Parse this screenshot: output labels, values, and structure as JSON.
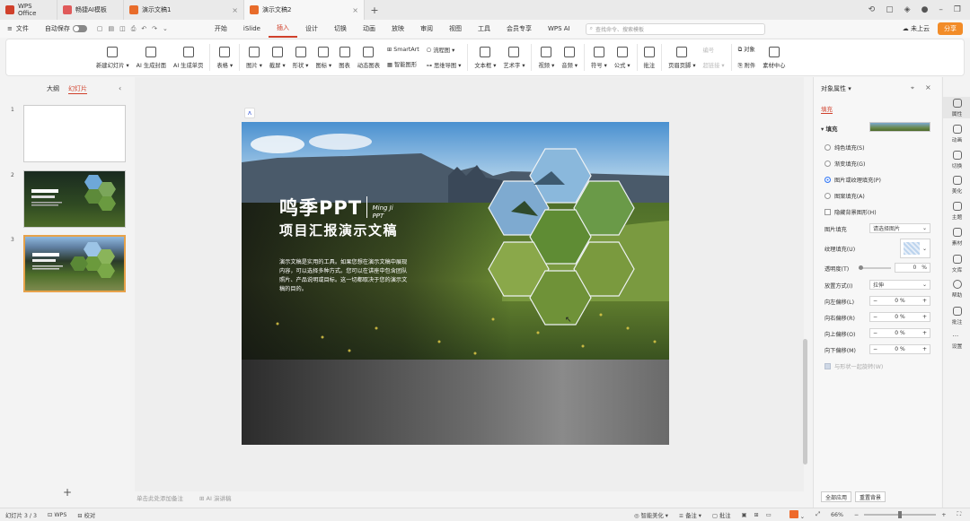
{
  "window": {
    "tabs": [
      {
        "label": "WPS Office",
        "icon": "wps-logo-icon",
        "color": "#d0402b"
      },
      {
        "label": "畅捷AI模板",
        "icon": "template-icon",
        "color": "#e05a5a"
      },
      {
        "label": "演示文稿1",
        "icon": "ppt-icon",
        "color": "#e86c2b"
      },
      {
        "label": "演示文稿2",
        "icon": "ppt-icon",
        "color": "#e86c2b"
      }
    ],
    "new_tab": "+"
  },
  "menubar": {
    "file": "文件",
    "autosave": "自动保存",
    "items": [
      "开始",
      "iSlide",
      "插入",
      "设计",
      "切换",
      "动画",
      "放映",
      "审阅",
      "视图",
      "工具",
      "会员专享",
      "WPS AI"
    ],
    "active": "插入",
    "search_placeholder": "查找命令、搜索模板",
    "not_cloud": "未上云",
    "share": "分享"
  },
  "ribbon": {
    "groups": [
      {
        "label": "新建幻灯片 ▾"
      },
      {
        "label": "AI 生成封面"
      },
      {
        "label": "AI 生成单页"
      },
      {
        "label": "表格 ▾"
      },
      {
        "label": "图片 ▾"
      },
      {
        "label": "截屏 ▾"
      },
      {
        "label": "形状 ▾"
      },
      {
        "label": "图标 ▾"
      },
      {
        "label": "图表"
      },
      {
        "label": "动态图表"
      }
    ],
    "smartart": "SmartArt",
    "smart_graphic": "智能图形",
    "flowchart": "流程图 ▾",
    "mindmap": "思维导图 ▾",
    "groups2": [
      {
        "label": "文本框 ▾"
      },
      {
        "label": "艺术字 ▾"
      },
      {
        "label": "视频 ▾"
      },
      {
        "label": "音频 ▾"
      },
      {
        "label": "符号 ▾"
      },
      {
        "label": "公式 ▾"
      },
      {
        "label": "批注"
      },
      {
        "label": "页眉页脚 ▾"
      }
    ],
    "disabled": [
      "编号",
      "超链接 ▾"
    ],
    "object": "对象",
    "attachment": "附件",
    "materials": "素材中心"
  },
  "leftpanel": {
    "tab_outline": "大纲",
    "tab_slides": "幻灯片",
    "slide_numbers": [
      "1",
      "2",
      "3"
    ],
    "add": "+"
  },
  "slide": {
    "title_main": "鸣季PPT",
    "title_en": "Ming Ji\nPPT",
    "subtitle": "项目汇报演示文稿",
    "body": "演示文稿是实用的工具。如果您想在演示文稿中展现内容，可以选择多种方式。您可以在讲座中包含团队照片、产品说明或目标。这一切都取决于您的演示文稿的目的。"
  },
  "notes": {
    "placeholder": "单击此处添加备注",
    "ai_script": "AI 演讲稿"
  },
  "rightpanel": {
    "title": "对象属性 ▾",
    "tab_fill": "填充",
    "section_fill": "填充",
    "options": [
      "纯色填充(S)",
      "渐变填充(G)",
      "图片或纹理填充(P)",
      "图案填充(A)"
    ],
    "selected_option": "图片或纹理填充(P)",
    "hide_bg": "隐藏背景图形(H)",
    "image_fill_label": "图片填充",
    "image_fill_value": "请选择图片",
    "texture_label": "纹理填充(U)",
    "transparency_label": "透明度(T)",
    "transparency_value": "0",
    "transparency_unit": "%",
    "placement_label": "放置方式(I)",
    "placement_value": "拉伸",
    "offsets": [
      {
        "label": "向左偏移(L)",
        "value": "0",
        "unit": "%"
      },
      {
        "label": "向右偏移(R)",
        "value": "0",
        "unit": "%"
      },
      {
        "label": "向上偏移(O)",
        "value": "0",
        "unit": "%"
      },
      {
        "label": "向下偏移(M)",
        "value": "0",
        "unit": "%"
      }
    ],
    "rotate_with_shape": "与形状一起旋转(W)",
    "apply_all": "全部应用",
    "reset_bg": "重置背景"
  },
  "sidebar": {
    "items": [
      "属性",
      "动画",
      "切换",
      "美化",
      "主题",
      "素材",
      "文库",
      "帮助",
      "批注",
      "设置"
    ]
  },
  "statusbar": {
    "slide_count": "幻灯片 3 / 3",
    "theme": "WPS",
    "proofread": "校对",
    "smart_beautify": "智能美化 ▾",
    "notes": "备注 ▾",
    "comments": "批注",
    "zoom": "66%"
  },
  "colors": {
    "accent": "#d0402b",
    "share": "#f28c28",
    "selected_thumb_border": "#e7a24a"
  }
}
